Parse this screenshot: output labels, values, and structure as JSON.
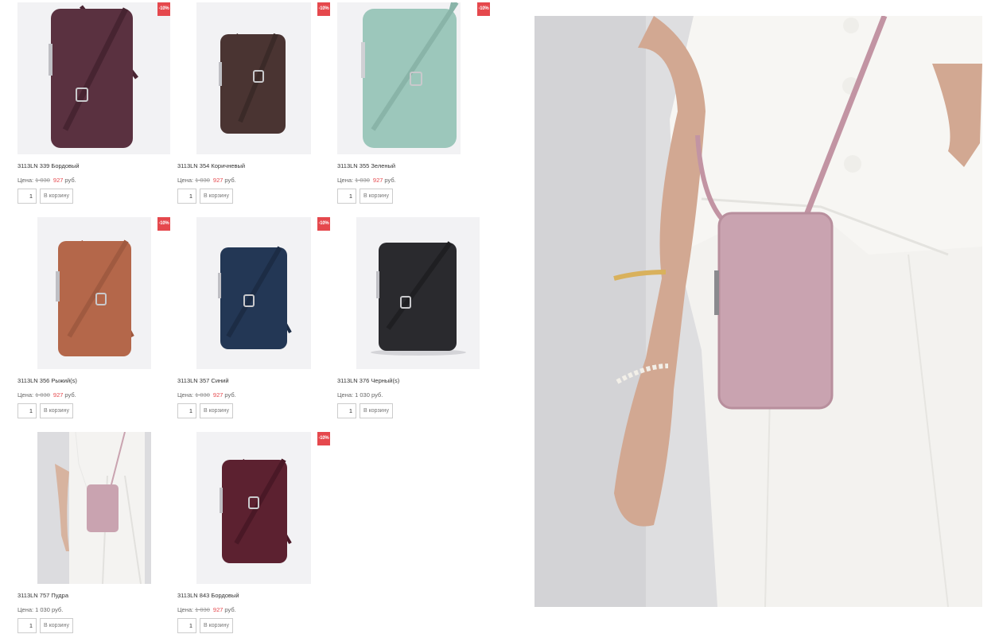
{
  "products": [
    {
      "name": "3113LN 339 Бордовый",
      "price_label": "Цена:",
      "old_price": "1 030",
      "new_price": "927",
      "currency": "руб.",
      "qty": "1",
      "cart_label": "В корзину",
      "badge": "-10%",
      "color": "#5a3140"
    },
    {
      "name": "3113LN 354 Коричневый",
      "price_label": "Цена:",
      "old_price": "1 030",
      "new_price": "927",
      "currency": "руб.",
      "qty": "1",
      "cart_label": "В корзину",
      "badge": "-10%",
      "color": "#4a3432"
    },
    {
      "name": "3113LN 355 Зеленый",
      "price_label": "Цена:",
      "old_price": "1 030",
      "new_price": "927",
      "currency": "руб.",
      "qty": "1",
      "cart_label": "В корзину",
      "badge": "-10%",
      "color": "#9cc7bb"
    },
    {
      "name": "3113LN 356 Рыжий(s)",
      "price_label": "Цена:",
      "old_price": "1 030",
      "new_price": "927",
      "currency": "руб.",
      "qty": "1",
      "cart_label": "В корзину",
      "badge": "-10%",
      "color": "#b4674a"
    },
    {
      "name": "3113LN 357 Синий",
      "price_label": "Цена:",
      "old_price": "1 030",
      "new_price": "927",
      "currency": "руб.",
      "qty": "1",
      "cart_label": "В корзину",
      "badge": "-10%",
      "color": "#233755"
    },
    {
      "name": "3113LN 376 Черный(s)",
      "price_label": "Цена:",
      "price": "1 030 руб.",
      "qty": "1",
      "cart_label": "В корзину",
      "color": "#2a2a2e"
    },
    {
      "name": "3113LN 757 Пудра",
      "price_label": "Цена:",
      "price": "1 030 руб.",
      "qty": "1",
      "cart_label": "В корзину",
      "color": "#c9a3b0"
    },
    {
      "name": "3113LN 843 Бордовый",
      "price_label": "Цена:",
      "old_price": "1 030",
      "new_price": "927",
      "currency": "руб.",
      "qty": "1",
      "cart_label": "В корзину",
      "badge": "-10%",
      "color": "#5c2130"
    }
  ],
  "hero": {
    "bag_color": "#c9a3b0"
  }
}
